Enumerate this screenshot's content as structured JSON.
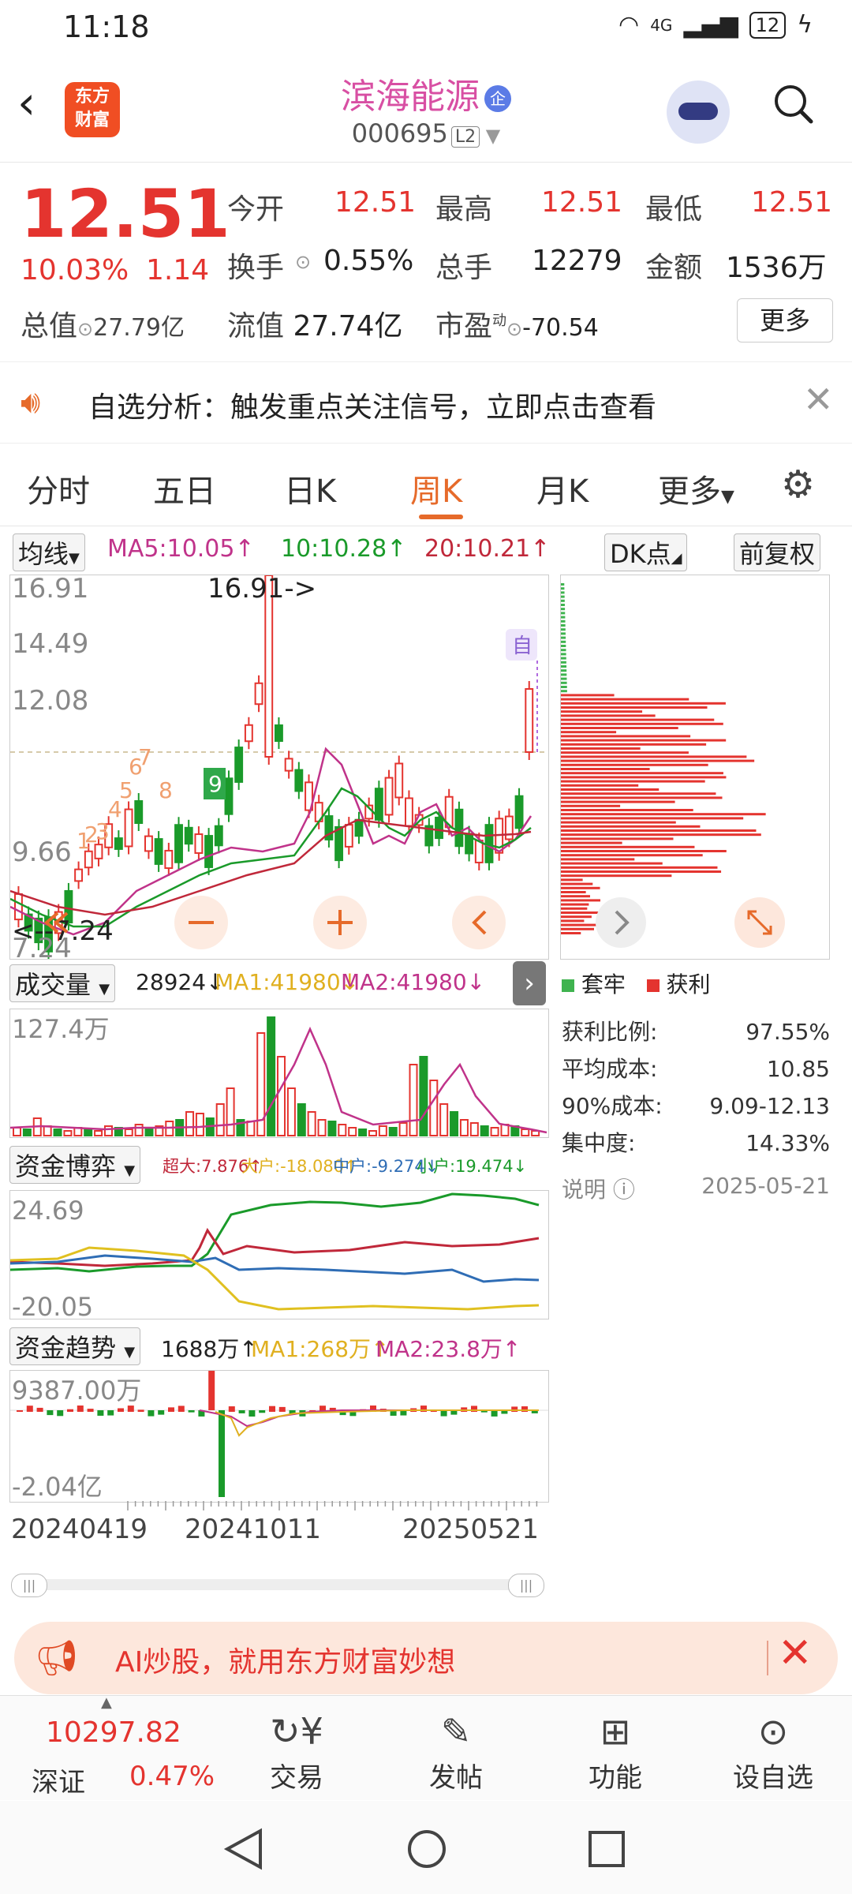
{
  "status": {
    "time": "11:18",
    "signal": "4G",
    "battery": "12"
  },
  "header": {
    "logo_line1": "东方",
    "logo_line2": "财富",
    "stock_name": "滨海能源",
    "badge": "企",
    "stock_code": "000695",
    "level": "L2"
  },
  "quote": {
    "price": "12.51",
    "change_pct": "10.03%",
    "change_amt": "1.14",
    "open_label": "今开",
    "open": "12.51",
    "high_label": "最高",
    "high": "12.51",
    "low_label": "最低",
    "low": "12.51",
    "turnover_label": "换手",
    "turnover": "0.55%",
    "volume_label": "总手",
    "volume": "12279",
    "amount_label": "金额",
    "amount": "1536万",
    "mktcap_label": "总值",
    "mktcap": "27.79亿",
    "float_label": "流值",
    "float": "27.74亿",
    "pe_label": "市盈",
    "pe_sup": "动",
    "pe": "-70.54",
    "more": "更多"
  },
  "banner": {
    "text": "自选分析：触发重点关注信号，立即点击查看"
  },
  "tabs": [
    "分时",
    "五日",
    "日K",
    "周K",
    "月K",
    "更多"
  ],
  "active_tab": "周K",
  "kline": {
    "ma_btn": "均线",
    "ma5": "MA5:10.05↑",
    "ma10": "10:10.28↑",
    "ma20": "20:10.21↑",
    "dk_btn": "DK点",
    "adjust_btn": "前复权",
    "y_labels": [
      "16.91",
      "14.49",
      "12.08",
      "9.66",
      "7.24"
    ],
    "max_label": "16.91->",
    "min_label": "<--7.24",
    "zi_tag": "自",
    "td_counts": [
      "1",
      "2",
      "3",
      "4",
      "5",
      "6",
      "7",
      "8",
      "9"
    ]
  },
  "chip": {
    "legend_trapped": "套牢",
    "legend_profit": "获利",
    "rows": [
      {
        "label": "获利比例:",
        "value": "97.55%"
      },
      {
        "label": "平均成本:",
        "value": "10.85"
      },
      {
        "label": "90%成本:",
        "value": "9.09-12.13"
      },
      {
        "label": "集中度:",
        "value": "14.33%"
      }
    ],
    "note": "说明",
    "date": "2025-05-21"
  },
  "volume": {
    "btn": "成交量",
    "value": "28924↓",
    "ma1": "MA1:41980↓",
    "ma2": "MA2:41980↓",
    "y_label": "127.4万"
  },
  "capital_game": {
    "btn": "资金博弈",
    "big": "超大:7.876↑",
    "large": "大户:-18.080↑",
    "mid": "中户:-9.274↓",
    "small": "小户:19.474↓",
    "y_top": "24.69",
    "y_bottom": "-20.05"
  },
  "capital_trend": {
    "btn": "资金趋势",
    "value": "1688万↑",
    "ma1": "MA1:268万↑",
    "ma2": "MA2:23.8万↑",
    "y_top": "9387.00万",
    "y_bottom": "-2.04亿"
  },
  "x_dates": [
    "20240419",
    "20241011",
    "20250521"
  ],
  "promo": {
    "text": "AI炒股，就用东方财富妙想"
  },
  "bottom_nav": {
    "index_value": "10297.82",
    "index_name": "深证",
    "index_pct": "0.47%",
    "items": [
      "交易",
      "发帖",
      "功能",
      "设自选"
    ]
  },
  "colors": {
    "up": "#e4342f",
    "down": "#1a9a2a",
    "accent": "#e66a2a",
    "name": "#d84fa3"
  }
}
